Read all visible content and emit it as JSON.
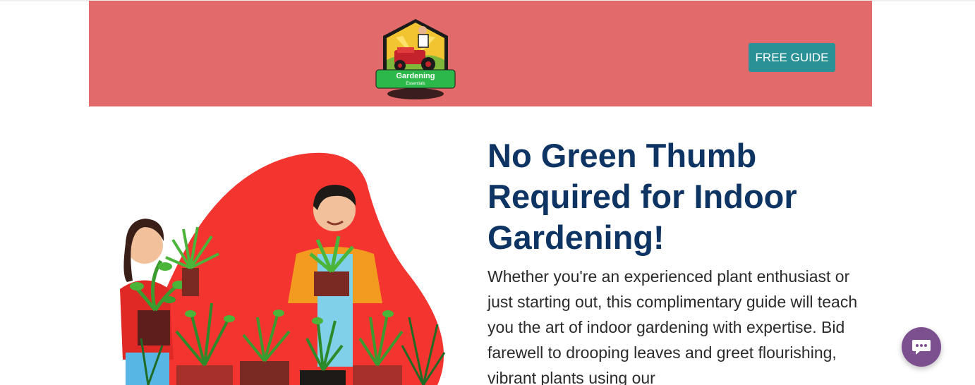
{
  "header": {
    "logo": {
      "name": "Gardening",
      "tagline": "Essentials"
    },
    "cta_label": "FREE GUIDE",
    "background_color": "#e36a6a",
    "button_color": "#2a9297"
  },
  "hero": {
    "headline": "No Green Thumb Required for Indoor Gardening!",
    "body": "Whether you're an experienced plant enthusiast or just starting out, this complimentary guide will teach you the art of indoor gardening with expertise. Bid farewell to drooping leaves and greet flourishing, vibrant plants using our",
    "headline_color": "#0d3463",
    "illustration": "people-with-potted-plants-illustration"
  },
  "chat": {
    "icon": "chat-bubble-icon",
    "color": "#7c4f8e"
  }
}
